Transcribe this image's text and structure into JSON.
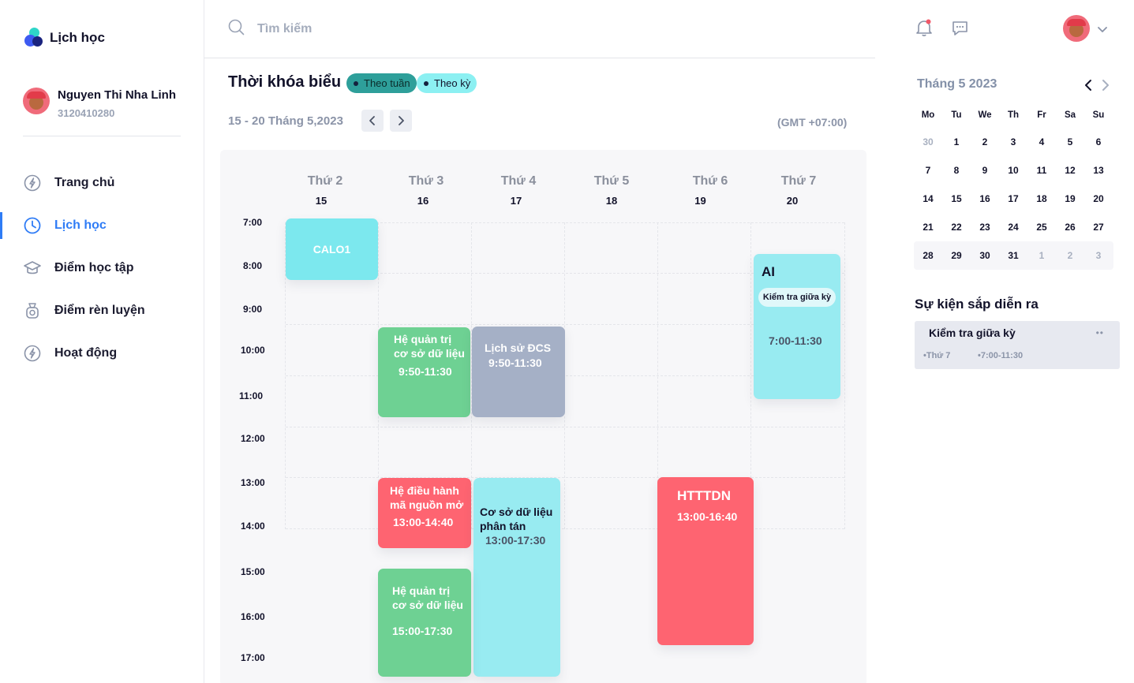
{
  "app": {
    "title": "Lịch học"
  },
  "user": {
    "name": "Nguyen Thi Nha Linh",
    "id": "3120410280"
  },
  "nav": [
    {
      "label": "Trang chủ",
      "icon": "home-bolt-icon"
    },
    {
      "label": "Lịch học",
      "icon": "clock-icon",
      "active": true
    },
    {
      "label": "Điểm học tập",
      "icon": "graduation-cap-icon"
    },
    {
      "label": "Điểm rèn luyện",
      "icon": "award-icon"
    },
    {
      "label": "Hoạt động",
      "icon": "activity-bolt-icon"
    }
  ],
  "search": {
    "placeholder": "Tìm kiếm"
  },
  "schedule": {
    "title": "Thời khóa biểu",
    "view_week": "Theo tuần",
    "view_term": "Theo kỳ",
    "range": "15 - 20 Tháng 5,2023",
    "timezone": "(GMT +07:00)",
    "days": [
      {
        "name": "Thứ 2",
        "date": "15"
      },
      {
        "name": "Thứ 3",
        "date": "16"
      },
      {
        "name": "Thứ 4",
        "date": "17"
      },
      {
        "name": "Thứ 5",
        "date": "18"
      },
      {
        "name": "Thứ 6",
        "date": "19"
      },
      {
        "name": "Thứ 7",
        "date": "20"
      }
    ],
    "times": [
      "7:00",
      "8:00",
      "9:00",
      "10:00",
      "11:00",
      "12:00",
      "13:00",
      "14:00",
      "15:00",
      "16:00",
      "17:00"
    ],
    "events": {
      "calo1": {
        "title": "CALO1",
        "time": ""
      },
      "hqt1": {
        "title1": "Hệ quản trị",
        "title2": "cơ sở dữ liệu",
        "time": "9:50-11:30"
      },
      "lsdcs": {
        "title": "Lịch sử ĐCS",
        "time": "9:50-11:30"
      },
      "ai": {
        "title": "AI",
        "badge": "Kiểm tra giữa kỳ",
        "time": "7:00-11:30"
      },
      "hdh": {
        "title1": "Hệ điều hành",
        "title2": "mã nguồn mở",
        "time": "13:00-14:40"
      },
      "csdlpt": {
        "title1": "Cơ sở dữ liệu",
        "title2": "phân tán",
        "time": "13:00-17:30"
      },
      "htttdn": {
        "title": "HTTTDN",
        "time": "13:00-16:40"
      },
      "hqt2": {
        "title1": "Hệ quản trị",
        "title2": "cơ sở dữ liệu",
        "time": "15:00-17:30"
      }
    }
  },
  "mini_calendar": {
    "title": "Tháng 5 2023",
    "weekdays": [
      "Mo",
      "Tu",
      "We",
      "Th",
      "Fr",
      "Sa",
      "Su"
    ],
    "weeks": [
      [
        "30",
        "1",
        "2",
        "3",
        "4",
        "5",
        "6"
      ],
      [
        "7",
        "8",
        "9",
        "10",
        "11",
        "12",
        "13"
      ],
      [
        "14",
        "15",
        "16",
        "17",
        "18",
        "19",
        "20"
      ],
      [
        "21",
        "22",
        "23",
        "24",
        "25",
        "26",
        "27"
      ],
      [
        "28",
        "29",
        "30",
        "31",
        "1",
        "2",
        "3"
      ]
    ]
  },
  "upcoming": {
    "title": "Sự kiện sắp diễn ra",
    "items": [
      {
        "name": "Kiểm tra giữa kỳ",
        "day": "•Thứ 7",
        "time": "•7:00-11:30",
        "more": "••"
      }
    ]
  }
}
